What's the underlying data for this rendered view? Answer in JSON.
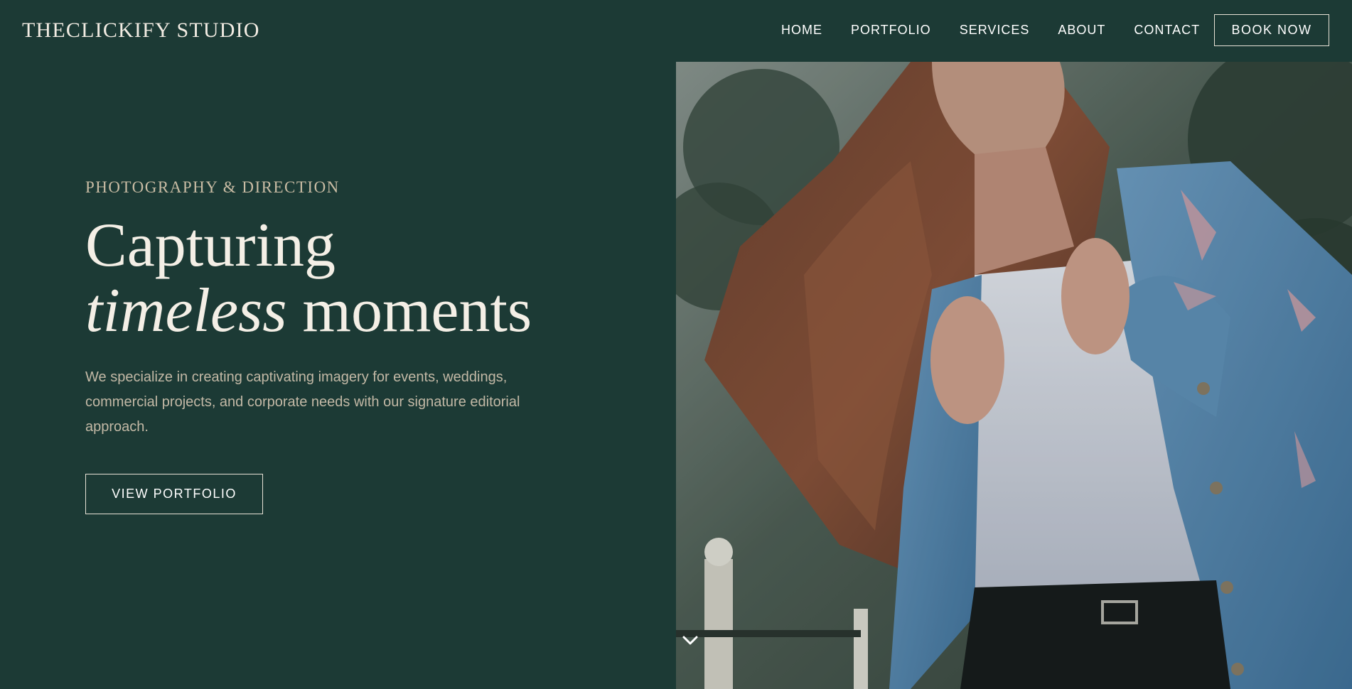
{
  "header": {
    "brand": "THECLICKIFY STUDIO",
    "nav": [
      {
        "label": "HOME"
      },
      {
        "label": "PORTFOLIO"
      },
      {
        "label": "SERVICES"
      },
      {
        "label": "ABOUT"
      },
      {
        "label": "CONTACT"
      }
    ],
    "book_label": "BOOK NOW"
  },
  "hero": {
    "eyebrow": "PHOTOGRAPHY & DIRECTION",
    "headline_line1": "Capturing",
    "headline_italic": "timeless",
    "headline_rest": " moments",
    "lead": "We specialize in creating captivating imagery for events, weddings, commercial projects, and corporate needs with our signature editorial approach.",
    "cta_label": "VIEW PORTFOLIO",
    "scroll_icon": "chevron-down-icon"
  },
  "colors": {
    "background": "#1c3a35",
    "accent_text": "#c9bca4",
    "headline": "#f4efe6",
    "border": "#e8e2d6"
  }
}
